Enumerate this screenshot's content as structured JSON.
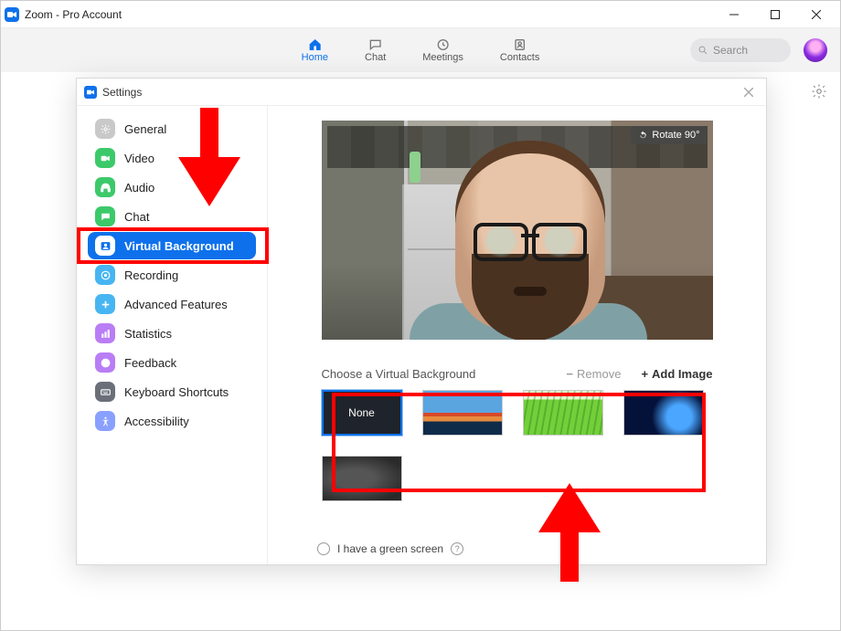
{
  "window": {
    "title": "Zoom - Pro Account"
  },
  "nav": {
    "items": [
      {
        "label": "Home",
        "active": true
      },
      {
        "label": "Chat",
        "active": false
      },
      {
        "label": "Meetings",
        "active": false
      },
      {
        "label": "Contacts",
        "active": false
      }
    ],
    "search_placeholder": "Search"
  },
  "settings": {
    "title": "Settings",
    "sidebar": [
      {
        "label": "General",
        "icon": "gear",
        "color": "#c9c9c9"
      },
      {
        "label": "Video",
        "icon": "camera",
        "color": "#3cc96a"
      },
      {
        "label": "Audio",
        "icon": "headset",
        "color": "#3cc96a"
      },
      {
        "label": "Chat",
        "icon": "chat",
        "color": "#3cc96a"
      },
      {
        "label": "Virtual Background",
        "icon": "person",
        "color": "#0e71eb",
        "active": true
      },
      {
        "label": "Recording",
        "icon": "record",
        "color": "#47b5f2"
      },
      {
        "label": "Advanced Features",
        "icon": "plus",
        "color": "#47b5f2"
      },
      {
        "label": "Statistics",
        "icon": "bars",
        "color": "#b97df5"
      },
      {
        "label": "Feedback",
        "icon": "smile",
        "color": "#b97df5"
      },
      {
        "label": "Keyboard Shortcuts",
        "icon": "keyboard",
        "color": "#6a6f7a"
      },
      {
        "label": "Accessibility",
        "icon": "access",
        "color": "#8aa0ff"
      }
    ],
    "preview": {
      "rotate_label": "Rotate 90°"
    },
    "choose_label": "Choose a Virtual Background",
    "remove_label": "Remove",
    "add_image_label": "Add Image",
    "backgrounds": {
      "none_label": "None",
      "items": [
        "none",
        "golden-gate-bridge",
        "grass",
        "earth-from-space",
        "fog"
      ]
    },
    "green_screen_label": "I have a green screen"
  },
  "annotations": {
    "arrow_to_sidebar_item": "Virtual Background",
    "arrow_to_thumbnails": true
  }
}
